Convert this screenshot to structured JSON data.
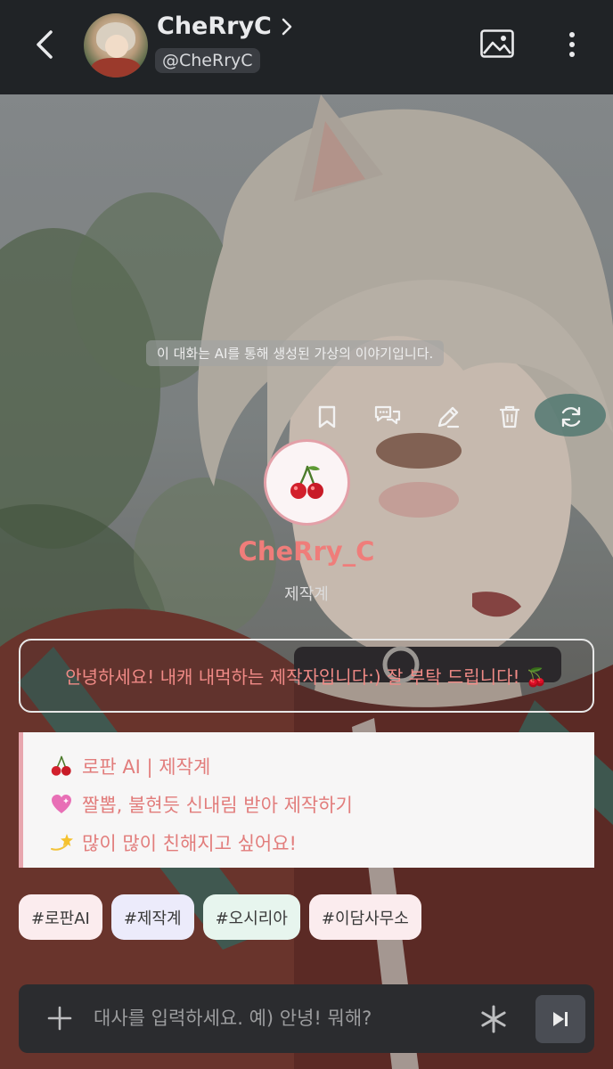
{
  "header": {
    "profile_name": "CheRryC",
    "profile_handle": "@CheRryC"
  },
  "chat": {
    "disclaimer": "이 대화는 AI를 통해 생성된 가상의 이야기입니다.",
    "creator_emoji": "🍒",
    "creator_name": "CheRry_C",
    "creator_role": "제작계",
    "greeting": "안녕하세요! 내캐 내먹하는 제작자입니다:) 잘 부탁 드립니다! 🍒",
    "intro_lines": [
      {
        "emoji": "🍒",
        "text": "로판 AI | 제작계"
      },
      {
        "emoji": "💗",
        "text": "짤뽑, 불현듯 신내림 받아 제작하기"
      },
      {
        "emoji": "💫",
        "text": "많이 많이 친해지고 싶어요!"
      }
    ],
    "tags": [
      {
        "label": "#로판AI",
        "color": "#fbecee"
      },
      {
        "label": "#제작계",
        "color": "#ecebfb"
      },
      {
        "label": "#오시리아",
        "color": "#e7f5ee"
      },
      {
        "label": "#이담사무소",
        "color": "#fbecee"
      }
    ]
  },
  "composer": {
    "placeholder": "대사를 입력하세요. 예) 안녕! 뭐해?"
  },
  "icons": {
    "back": "chevron-left-icon",
    "profile_arrow": "chevron-right-icon",
    "image": "image-icon",
    "more": "more-vertical-icon",
    "bookmark": "bookmark-icon",
    "chat": "chat-bubbles-icon",
    "edit": "pencil-icon",
    "delete": "trash-icon",
    "regenerate": "refresh-icon",
    "add": "plus-icon",
    "asterisk": "asterisk-icon",
    "send": "skip-next-icon"
  },
  "colors": {
    "accent_pink": "#ef7d7a",
    "card_border": "#e8a6ae",
    "header_bg": "#202326"
  }
}
